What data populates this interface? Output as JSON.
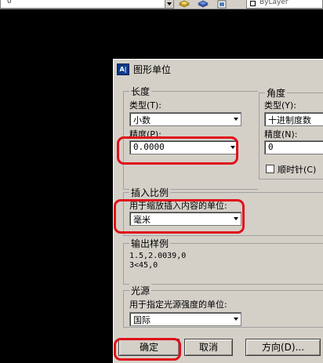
{
  "toolbar": {
    "left_value": "0",
    "layer_value": "ByLayer"
  },
  "dialog": {
    "title": "图形单位",
    "title_icon": "A|",
    "length": {
      "group_label": "长度",
      "type_label": "类型(T):",
      "type_value": "小数",
      "precision_label": "精度(P):",
      "precision_value": "0.0000"
    },
    "angle": {
      "group_label": "角度",
      "type_label": "类型(Y):",
      "type_value": "十进制度数",
      "precision_label": "精度(N):",
      "precision_value": "0",
      "clockwise_label": "顺时针(C)",
      "clockwise_checked": false
    },
    "insert_scale": {
      "group_label": "插入比例",
      "units_label": "用于缩放插入内容的单位:",
      "units_value": "毫米"
    },
    "sample": {
      "group_label": "输出样例",
      "line1": "1.5,2.0039,0",
      "line2": "3<45,0"
    },
    "lighting": {
      "group_label": "光源",
      "units_label": "用于指定光源强度的单位:",
      "units_value": "国际"
    },
    "buttons": {
      "ok": "确定",
      "cancel": "取消",
      "direction": "方向(D)..."
    }
  },
  "colors": {
    "annotation_red": "#e0101a",
    "dialog_bg": "#d4d0c8"
  }
}
